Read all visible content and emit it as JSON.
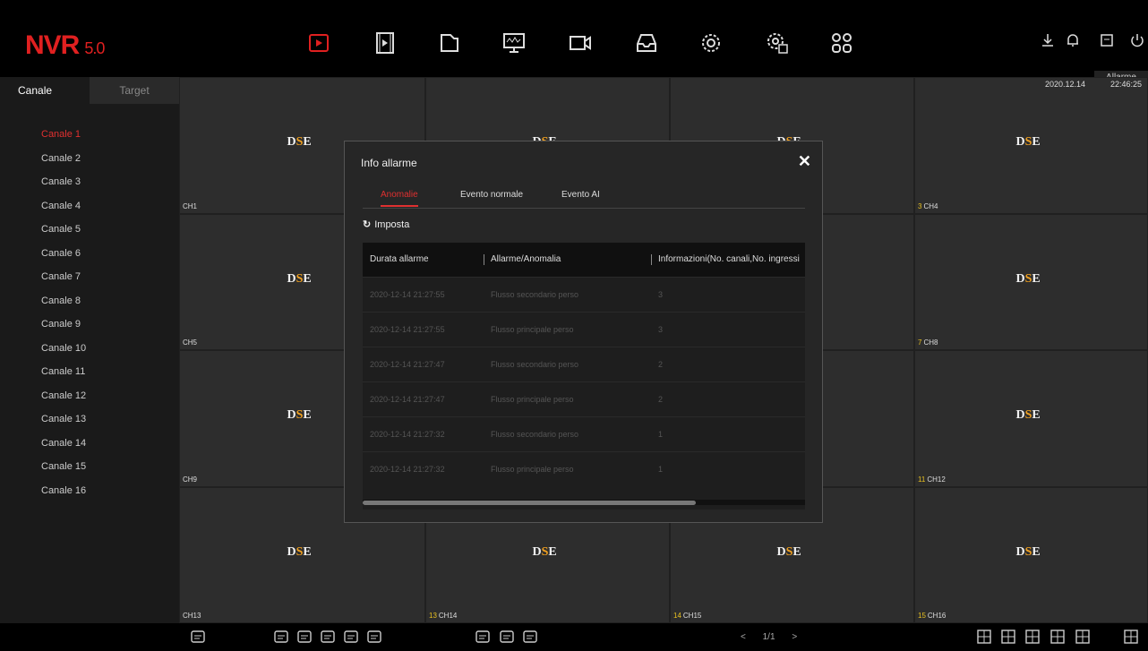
{
  "app": {
    "name": "NVR",
    "version": "5.0"
  },
  "topbar": {
    "main_icons": [
      "playback-icon",
      "film-icon",
      "folder-icon",
      "monitor-icon",
      "camera-icon",
      "storage-icon",
      "settings-icon",
      "advanced-settings-icon",
      "apps-icon"
    ],
    "right_icons": [
      "download-icon",
      "bell-icon",
      "save-icon",
      "power-icon"
    ],
    "tooltip": "Allarme"
  },
  "datetime": {
    "date": "2020.12.14",
    "time": "22:46:25"
  },
  "sidebar": {
    "tabs": [
      "Canale",
      "Target"
    ],
    "channels": [
      "Canale 1",
      "Canale 2",
      "Canale 3",
      "Canale 4",
      "Canale 5",
      "Canale 6",
      "Canale 7",
      "Canale 8",
      "Canale 9",
      "Canale 10",
      "Canale 11",
      "Canale 12",
      "Canale 13",
      "Canale 14",
      "Canale 15",
      "Canale 16"
    ]
  },
  "grid": {
    "brand": "DSE",
    "labels": [
      {
        "num": "",
        "ch": "CH1"
      },
      {
        "num": "",
        "ch": ""
      },
      {
        "num": "",
        "ch": ""
      },
      {
        "num": "3",
        "ch": "CH4"
      },
      {
        "num": "",
        "ch": "CH5"
      },
      {
        "num": "",
        "ch": ""
      },
      {
        "num": "",
        "ch": ""
      },
      {
        "num": "7",
        "ch": "CH8"
      },
      {
        "num": "",
        "ch": "CH9"
      },
      {
        "num": "",
        "ch": ""
      },
      {
        "num": "",
        "ch": ""
      },
      {
        "num": "11",
        "ch": "CH12"
      },
      {
        "num": "",
        "ch": "CH13"
      },
      {
        "num": "13",
        "ch": "CH14"
      },
      {
        "num": "14",
        "ch": "CH15"
      },
      {
        "num": "15",
        "ch": "CH16"
      }
    ]
  },
  "modal": {
    "title": "Info allarme",
    "close": "✕",
    "tabs": [
      "Anomalie",
      "Evento normale",
      "Evento AI"
    ],
    "imposta": "Imposta",
    "columns": [
      "Durata allarme",
      "Allarme/Anomalia",
      "Informazioni(No. canali,No. ingressi"
    ],
    "rows": [
      [
        "2020-12-14 21:27:55",
        "Flusso secondario perso",
        "3"
      ],
      [
        "2020-12-14 21:27:55",
        "Flusso principale perso",
        "3"
      ],
      [
        "2020-12-14 21:27:47",
        "Flusso secondario perso",
        "2"
      ],
      [
        "2020-12-14 21:27:47",
        "Flusso principale perso",
        "2"
      ],
      [
        "2020-12-14 21:27:32",
        "Flusso secondario perso",
        "1"
      ],
      [
        "2020-12-14 21:27:32",
        "Flusso principale perso",
        "1"
      ]
    ]
  },
  "bottombar": {
    "pager": "1/1",
    "left_icons": [
      "alarm-icon",
      "record-search-icon",
      "image-search-icon",
      "calendar-icon",
      "network-icon",
      "list-icon",
      "ptz-icon",
      "osd-off-icon",
      "group-icon"
    ],
    "layout_icons": [
      "layout-1-icon",
      "layout-4-icon",
      "layout-6-icon",
      "layout-9-icon",
      "layout-16-icon",
      "fullscreen-icon"
    ]
  }
}
